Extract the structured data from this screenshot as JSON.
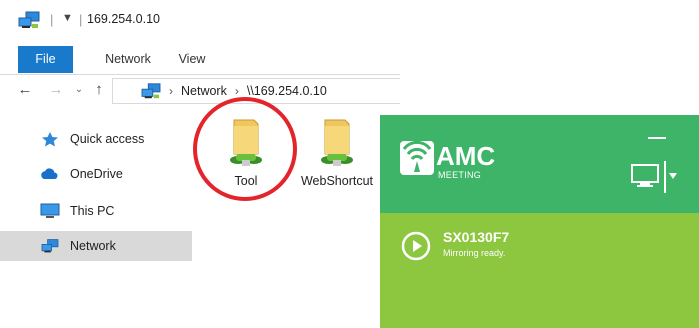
{
  "explorer": {
    "title": "169.254.0.10",
    "tabs": [
      {
        "label": "File"
      },
      {
        "label": "Network"
      },
      {
        "label": "View"
      }
    ],
    "address": {
      "segments": [
        "Network",
        "\\\\169.254.0.10"
      ]
    },
    "nav_items": [
      {
        "label": "Quick access",
        "icon": "star-icon"
      },
      {
        "label": "OneDrive",
        "icon": "cloud-icon"
      },
      {
        "label": "This PC",
        "icon": "computer-icon"
      },
      {
        "label": "Network",
        "icon": "network-icon",
        "selected": true
      }
    ],
    "items": [
      {
        "name": "Tool",
        "icon": "shared-folder-icon",
        "highlighted": true
      },
      {
        "name": "WebShortcut",
        "icon": "shared-folder-icon"
      }
    ],
    "colors": {
      "file_tab": "#1979ca",
      "highlight_circle": "#e3242b",
      "selected_nav": "#d9d9d9"
    }
  },
  "amc": {
    "app_name": "AMC",
    "app_sub": "MEETING",
    "device_name": "SX0130F7",
    "status": "Mirroring ready.",
    "colors": {
      "header": "#3db467",
      "body": "#8dc63f"
    }
  }
}
